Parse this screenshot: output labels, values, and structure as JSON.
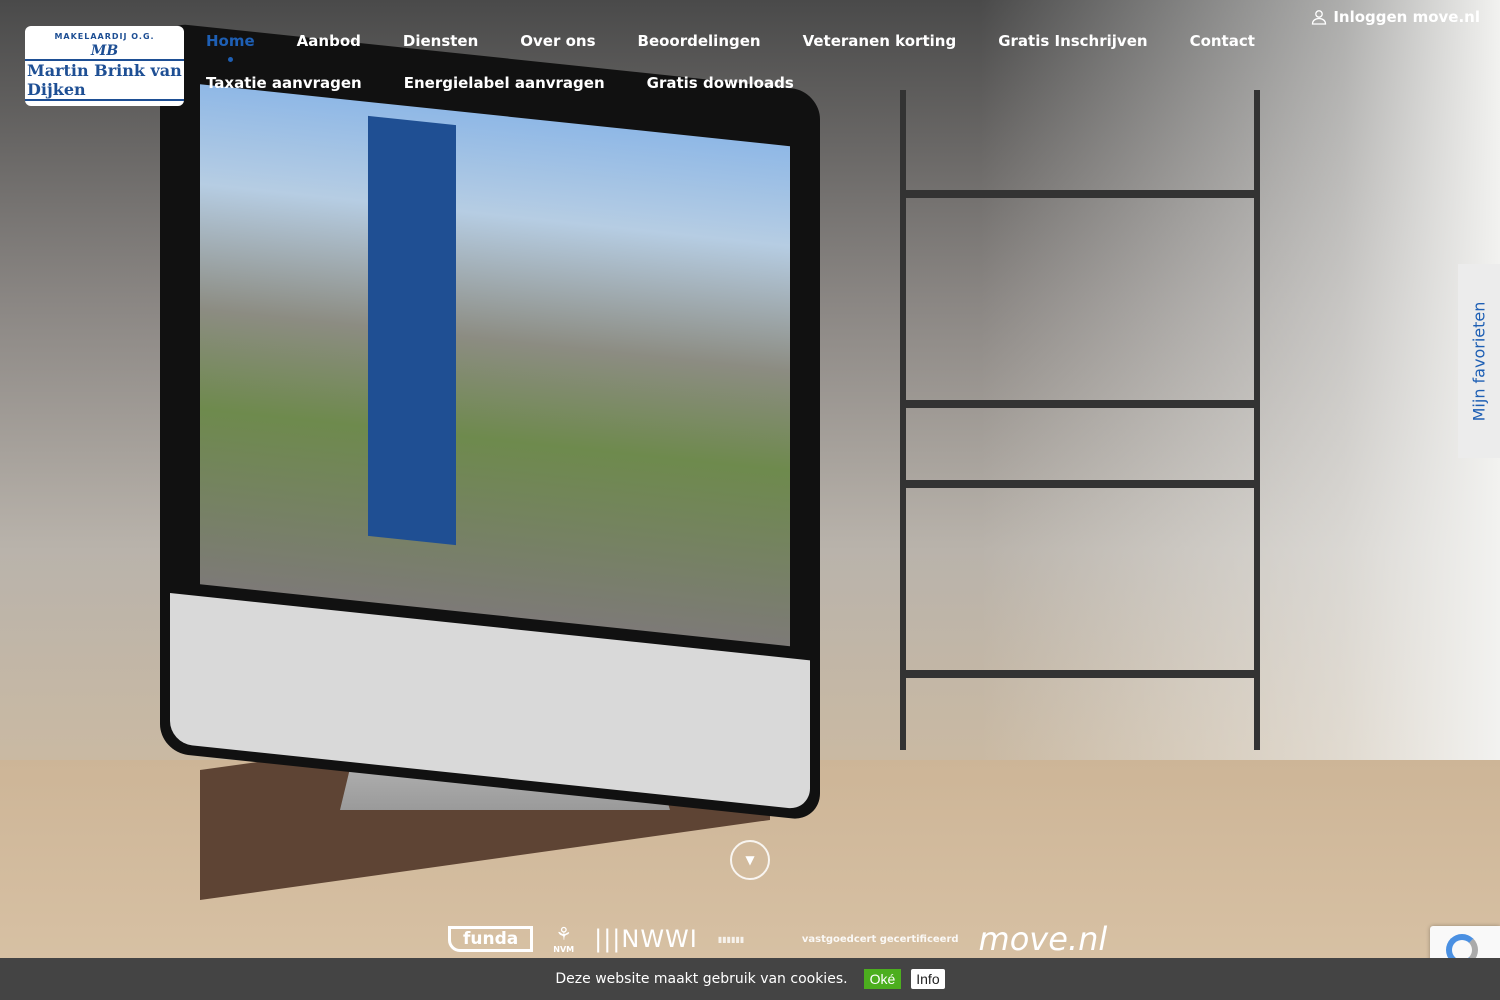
{
  "brand": {
    "logo_top": "MAKELAARDIJ O.G.",
    "logo_mark": "MB",
    "logo_name": "Martin Brink van Dijken",
    "accent": "#1e5fb4"
  },
  "nav": {
    "items": [
      {
        "label": "Home",
        "active": true
      },
      {
        "label": "Aanbod"
      },
      {
        "label": "Diensten"
      },
      {
        "label": "Over ons"
      },
      {
        "label": "Beoordelingen"
      },
      {
        "label": "Veteranen korting"
      },
      {
        "label": "Gratis Inschrijven"
      },
      {
        "label": "Contact"
      },
      {
        "label": "Taxatie aanvragen"
      },
      {
        "label": "Energielabel aanvragen"
      },
      {
        "label": "Gratis downloads"
      }
    ]
  },
  "login": {
    "label": "Inloggen move.nl",
    "icon": "user-icon"
  },
  "favorites": {
    "label": "Mijn favorieten"
  },
  "scroll_icon": "chevron-down-icon",
  "partners": {
    "funda": "funda",
    "nvm": "NVM",
    "nwwi": "NWWI",
    "vastgoedcert": "vastgoedcert gecertificeerd",
    "move": "move.nl"
  },
  "cookie": {
    "text": "Deze website maakt gebruik van cookies.",
    "ok": "Oké",
    "info": "Info",
    "ok_color": "#4cae1e"
  }
}
